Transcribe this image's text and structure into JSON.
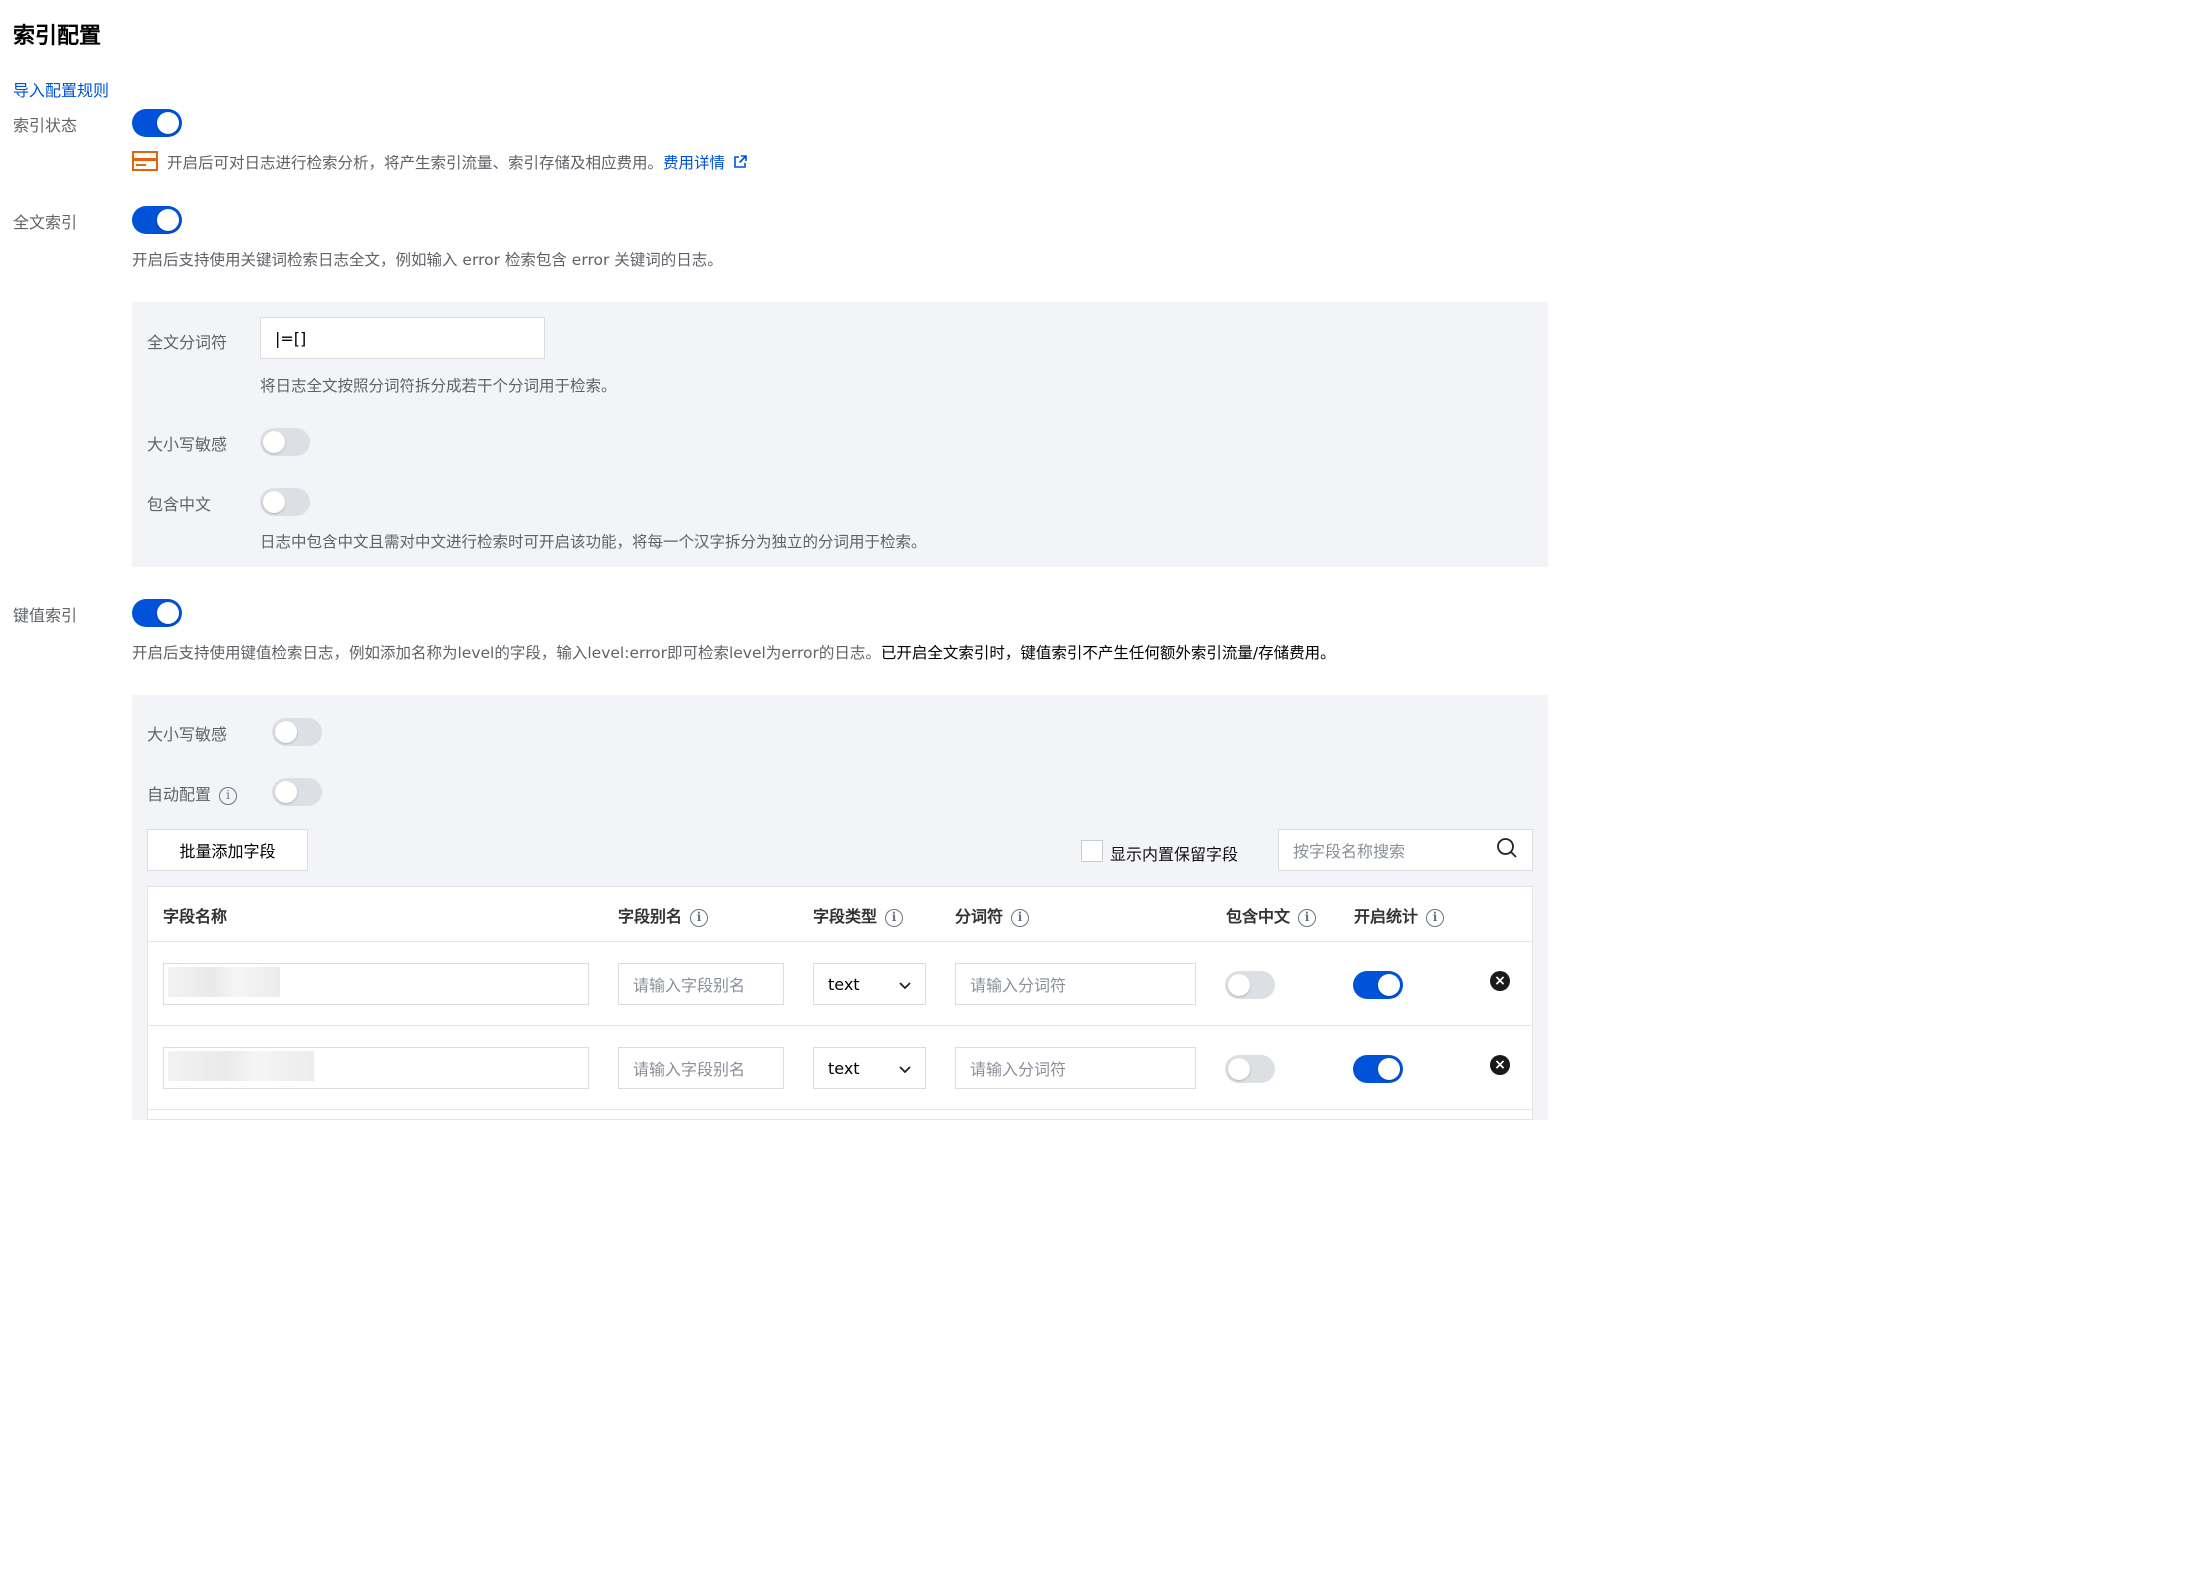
{
  "title": "索引配置",
  "import_link": "导入配置规则",
  "index_status": {
    "label": "索引状态",
    "enabled": true,
    "notice": "开启后可对日志进行检索分析，将产生索引流量、索引存储及相应费用。",
    "fee_link": "费用详情"
  },
  "fulltext": {
    "label": "全文索引",
    "enabled": true,
    "desc": "开启后支持使用关键词检索日志全文，例如输入 error 检索包含 error 关键词的日志。",
    "tokenizer_label": "全文分词符",
    "tokenizer_value": "|=[]",
    "tokenizer_desc": "将日志全文按照分词符拆分成若干个分词用于检索。",
    "case_label": "大小写敏感",
    "case_enabled": false,
    "chinese_label": "包含中文",
    "chinese_enabled": false,
    "chinese_desc": "日志中包含中文且需对中文进行检索时可开启该功能，将每一个汉字拆分为独立的分词用于检索。"
  },
  "kv": {
    "label": "键值索引",
    "enabled": true,
    "desc": "开启后支持使用键值检索日志，例如添加名称为level的字段，输入level:error即可检索level为error的日志。",
    "desc_strong": "已开启全文索引时，键值索引不产生任何额外索引流量/存储费用。",
    "case_label": "大小写敏感",
    "case_enabled": false,
    "auto_label": "自动配置",
    "auto_enabled": false,
    "bulk_add_button": "批量添加字段",
    "show_builtin_label": "显示内置保留字段",
    "search_placeholder": "按字段名称搜索",
    "table": {
      "headers": [
        "字段名称",
        "字段别名",
        "字段类型",
        "分词符",
        "包含中文",
        "开启统计"
      ],
      "rows": [
        {
          "alias_placeholder": "请输入字段别名",
          "type": "text",
          "tokenizer_placeholder": "请输入分词符",
          "chinese": false,
          "stats": true
        },
        {
          "alias_placeholder": "请输入字段别名",
          "type": "text",
          "tokenizer_placeholder": "请输入分词符",
          "chinese": false,
          "stats": true
        }
      ]
    }
  }
}
